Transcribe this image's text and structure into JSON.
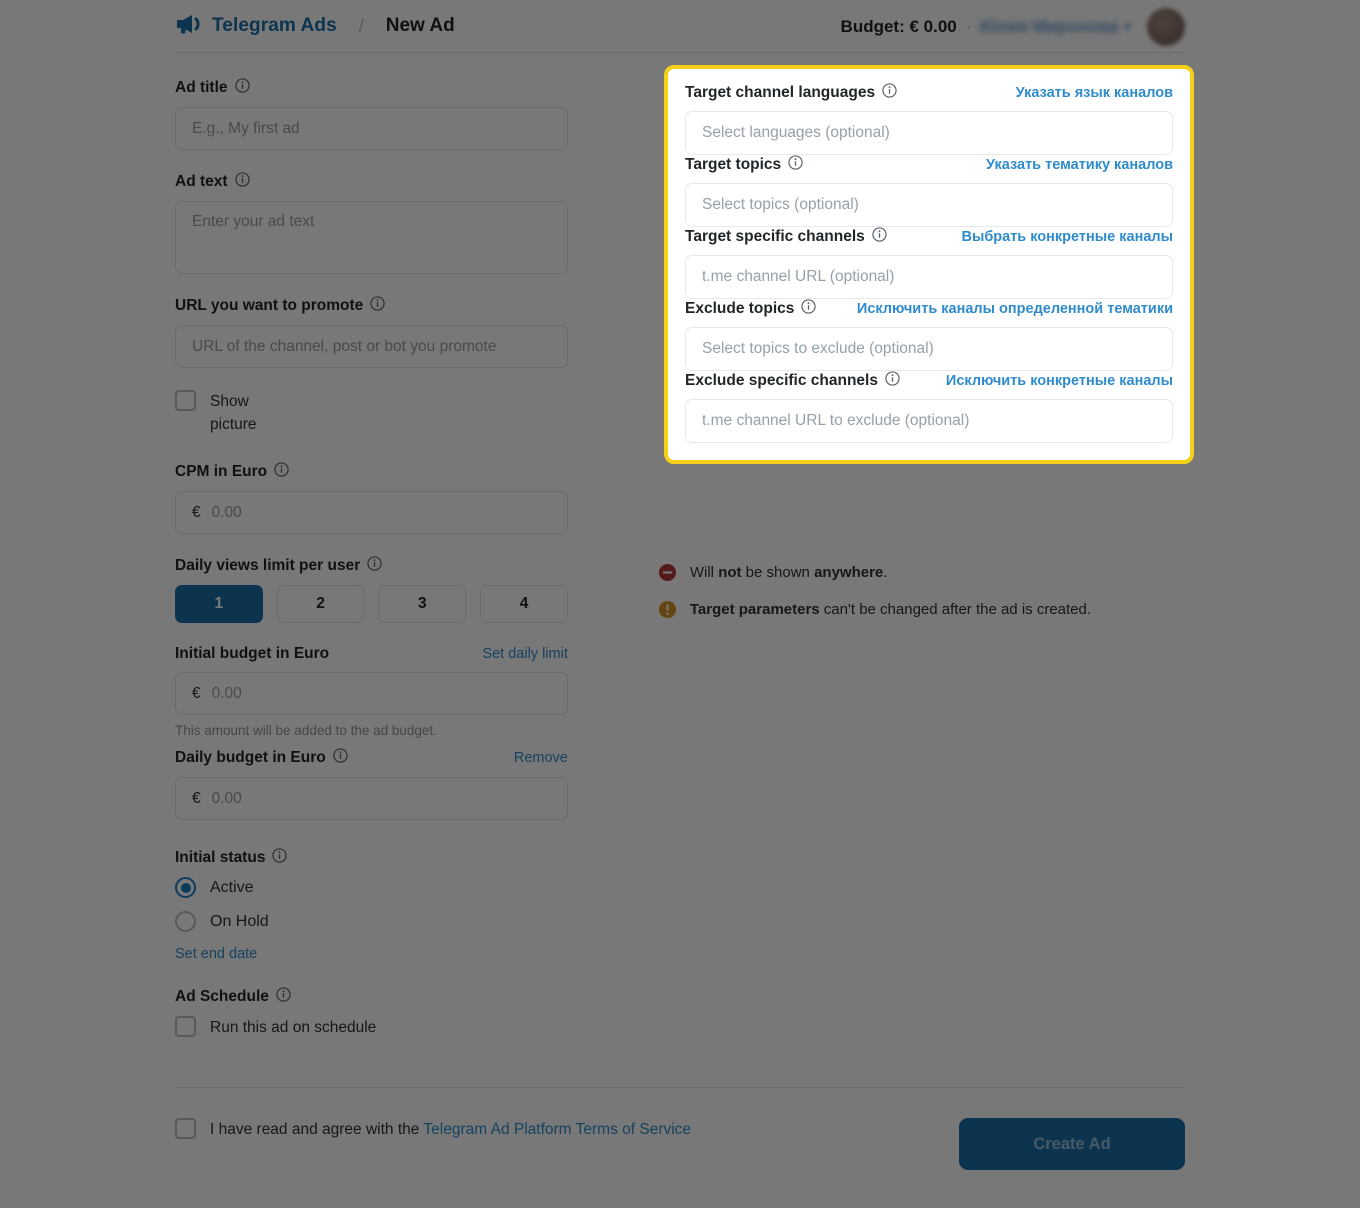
{
  "header": {
    "logo_icon": "megaphone-icon",
    "brand": "Telegram Ads",
    "separator": "/",
    "current": "New Ad",
    "budget": "Budget: € 0.00",
    "dot": "·",
    "user_name": "Юлия Миронова",
    "caret_icon": "chevron-down-icon",
    "avatar_icon": "avatar"
  },
  "left": {
    "ad_title": {
      "label": "Ad title",
      "placeholder": "E.g., My first ad",
      "info_icon": "info-icon"
    },
    "ad_text": {
      "label": "Ad text",
      "placeholder": "Enter your ad text",
      "info_icon": "info-icon"
    },
    "url": {
      "label": "URL you want to promote",
      "placeholder": "URL of the channel, post or bot you promote",
      "info_icon": "info-icon"
    },
    "show_picture": {
      "label": "Show picture",
      "checked": false
    },
    "cpm": {
      "label": "CPM in Euro",
      "currency": "€",
      "placeholder": "0.00",
      "info_icon": "info-icon"
    },
    "daily_views": {
      "label": "Daily views limit per user",
      "info_icon": "info-icon",
      "options": [
        "1",
        "2",
        "3",
        "4"
      ],
      "selected": "1"
    },
    "initial_budget": {
      "label": "Initial budget in Euro",
      "action": "Set daily limit",
      "currency": "€",
      "placeholder": "0.00",
      "hint": "This amount will be added to the ad budget."
    },
    "daily_budget": {
      "label": "Daily budget in Euro",
      "info_icon": "info-icon",
      "action": "Remove",
      "currency": "€",
      "placeholder": "0.00"
    },
    "initial_status": {
      "label": "Initial status",
      "info_icon": "info-icon",
      "options": [
        "Active",
        "On Hold"
      ],
      "selected": "Active",
      "end_date_link": "Set end date"
    },
    "ad_schedule": {
      "label": "Ad Schedule",
      "info_icon": "info-icon",
      "checkbox_label": "Run this ad on schedule",
      "checked": false
    }
  },
  "panel": {
    "highlighted": true,
    "highlight_color": "#f5d018",
    "fields": [
      {
        "label": "Target channel languages",
        "info_icon": "info-icon",
        "action": "Указать язык каналов",
        "placeholder": "Select languages (optional)"
      },
      {
        "label": "Target topics",
        "info_icon": "info-icon",
        "action": "Указать тематику каналов",
        "placeholder": "Select topics (optional)"
      },
      {
        "label": "Target specific channels",
        "info_icon": "info-icon",
        "action": "Выбрать конкретные каналы",
        "placeholder": "t.me channel URL (optional)"
      },
      {
        "label": "Exclude topics",
        "info_icon": "info-icon",
        "action": "Исключить каналы определенной тематики",
        "placeholder": "Select topics to exclude (optional)"
      },
      {
        "label": "Exclude specific channels",
        "info_icon": "info-icon",
        "action": "Исключить конкретные каналы",
        "placeholder": "t.me channel URL to exclude (optional)"
      }
    ]
  },
  "notes": [
    {
      "icon": "minus-circle-icon",
      "color": "#b03a3a",
      "prefix": "Will ",
      "bold1": "not",
      "middle": " be shown ",
      "bold2": "anywhere",
      "suffix": "."
    },
    {
      "icon": "exclamation-circle-icon",
      "color": "#d3962a",
      "bold1": "Target parameters",
      "middle": " can't be changed after the ad is created.",
      "prefix": "",
      "bold2": "",
      "suffix": ""
    }
  ],
  "footer": {
    "terms_prefix": "I have read and agree with the ",
    "terms_link": "Telegram Ad Platform Terms of Service",
    "terms_checked": false,
    "create_button": "Create Ad"
  }
}
